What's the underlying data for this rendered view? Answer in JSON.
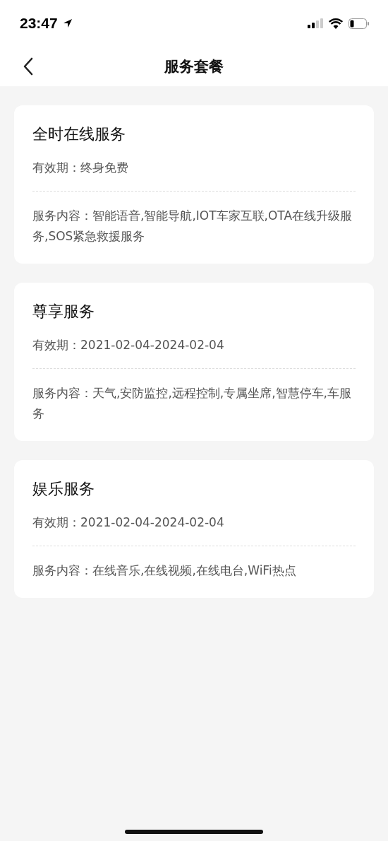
{
  "status_bar": {
    "time": "23:47"
  },
  "nav": {
    "title": "服务套餐"
  },
  "packages": [
    {
      "name": "全时在线服务",
      "validity": "有效期：终身免费",
      "content": "服务内容：智能语音,智能导航,IOT车家互联,OTA在线升级服务,SOS紧急救援服务"
    },
    {
      "name": "尊享服务",
      "validity": "有效期：2021-02-04-2024-02-04",
      "content": "服务内容：天气,安防监控,远程控制,专属坐席,智慧停车,车服务"
    },
    {
      "name": "娱乐服务",
      "validity": "有效期：2021-02-04-2024-02-04",
      "content": "服务内容：在线音乐,在线视频,在线电台,WiFi热点"
    }
  ]
}
